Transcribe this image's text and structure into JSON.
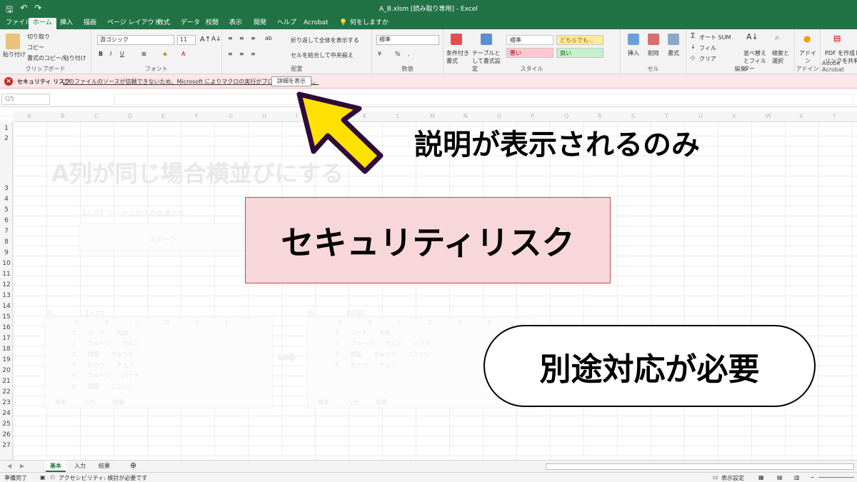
{
  "window": {
    "title": "A_B.xlsm [読み取り専用] - Excel"
  },
  "tabs": [
    "ファイル",
    "ホーム",
    "挿入",
    "描画",
    "ページ レイアウト",
    "数式",
    "データ",
    "校閲",
    "表示",
    "開発",
    "ヘルプ",
    "Acrobat",
    "何をしますか"
  ],
  "ribbon": {
    "clipboard": {
      "paste": "貼り付け",
      "cut": "切り取り",
      "copy": "コピー",
      "format_painter": "書式のコピー/貼り付け",
      "group": "クリップボード"
    },
    "font": {
      "name": "游ゴシック",
      "size": "11",
      "group": "フォント"
    },
    "alignment": {
      "wrap": "折り返して全体を表示する",
      "merge": "セルを結合して中央揃え",
      "group": "配置"
    },
    "number": {
      "format": "標準",
      "group": "数値"
    },
    "styles": {
      "conditional": "条件付き書式",
      "as_table": "テーブルとして書式設定",
      "standard": "標準",
      "neutral": "どちらでも...",
      "bad": "悪い",
      "good": "良い",
      "group": "スタイル"
    },
    "cells": {
      "insert": "挿入",
      "delete": "削除",
      "format": "書式",
      "group": "セル"
    },
    "editing": {
      "autosum": "オート SUM",
      "fill": "フィル",
      "clear": "クリア",
      "sort_filter": "並べ替えとフィルター",
      "find_select": "検索と選択",
      "group": "編集"
    },
    "addins": {
      "addin": "アドイン",
      "group": "アドイン"
    },
    "acrobat": {
      "pdf": "PDF を作成してリンクを共有",
      "group": "Adobe Acrobat"
    }
  },
  "security_bar": {
    "title": "セキュリティ リスク",
    "message": "このファイルのソースが信頼できないため、Microsoft によりマクロの実行がブロックされました。",
    "button": "詳細を表示"
  },
  "formula_bar": {
    "name_box": "Q5"
  },
  "columns": [
    "A",
    "B",
    "C",
    "D",
    "E",
    "F",
    "G",
    "H",
    "I",
    "J",
    "K",
    "L",
    "M",
    "N",
    "O",
    "P",
    "Q",
    "R",
    "S",
    "T",
    "U",
    "V",
    "W",
    "X",
    "Y"
  ],
  "rows": [
    "1",
    "2",
    "3",
    "4",
    "5",
    "6",
    "7",
    "8",
    "9",
    "10",
    "11",
    "12",
    "13",
    "14",
    "15",
    "16",
    "17",
    "18",
    "19",
    "20",
    "21",
    "22",
    "23",
    "24",
    "25",
    "26",
    "27"
  ],
  "faded_sheet": {
    "heading": "A列が同じ場合横並びにする",
    "instruction": "【入力】シートに記入が出来たら",
    "button": "スタート",
    "example_label": "例",
    "input_label": "【入力】",
    "result_label": "【結果】",
    "col_headers": [
      "A",
      "B",
      "C",
      "D",
      "E",
      "F"
    ],
    "input_rows": [
      [
        "1",
        "コード",
        "内容"
      ],
      [
        "2",
        "フルーツ",
        "りんご"
      ],
      [
        "3",
        "野菜",
        "きゅうり"
      ],
      [
        "4",
        "おやつ",
        "チョコ"
      ],
      [
        "5",
        "フルーツ",
        "バナナ"
      ],
      [
        "6",
        "野菜",
        "ニンジン"
      ]
    ],
    "result_rows": [
      [
        "1",
        "コード",
        "内容"
      ],
      [
        "2",
        "フルーツ",
        "りんご",
        "バナナ"
      ],
      [
        "3",
        "野菜",
        "きゅうり",
        "ニンジン"
      ],
      [
        "4",
        "おやつ",
        "チョコ"
      ]
    ],
    "mini_tabs": [
      "基本",
      "入力",
      "結果"
    ]
  },
  "overlays": {
    "caption": "説明が表示されるのみ",
    "center_label": "セキュリティリスク",
    "pill_label": "別途対応が必要",
    "arrow_color": "#ffe100",
    "arrow_outline": "#2d0b3a"
  },
  "sheets": [
    "基本",
    "入力",
    "結果"
  ],
  "status": {
    "ready": "準備完了",
    "accessibility": "アクセシビリティ: 検討が必要です",
    "display_settings": "表示設定"
  },
  "colors": {
    "excel_green": "#217346",
    "security_bg": "#fde7e9",
    "center_box_bg": "#f8d7da"
  }
}
